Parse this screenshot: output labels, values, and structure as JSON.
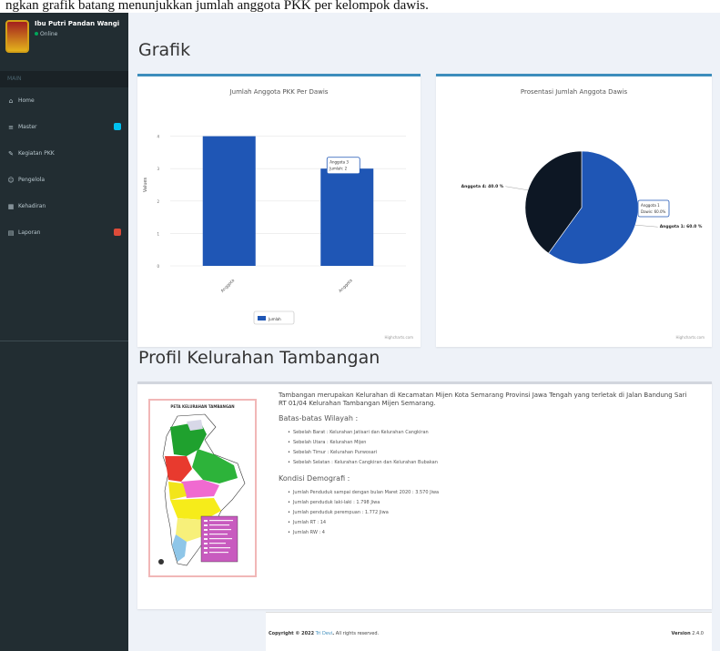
{
  "caption": "ngkan grafik batang menunjukkan jumlah anggota PKK per kelompok dawis.",
  "sidebar": {
    "user_name": "Ibu Putri Pandan Wangi",
    "user_status": "Online",
    "header": "MAIN",
    "items": [
      {
        "label": "Home",
        "icon": "home-icon"
      },
      {
        "label": "Master",
        "icon": "database-icon",
        "badge_color": "#00c0ef"
      },
      {
        "label": "Kegiatan PKK",
        "icon": "pencil-icon"
      },
      {
        "label": "Pengelola",
        "icon": "users-icon"
      },
      {
        "label": "Kehadiran",
        "icon": "table-icon"
      },
      {
        "label": "Laporan",
        "icon": "book-icon",
        "badge_color": "#dd4b39"
      }
    ]
  },
  "grafik": {
    "title": "Grafik",
    "bar_box_title": "Jumlah Anggota PKK Per Dawis",
    "pie_box_title": "Prosentasi Jumlah Anggota Dawis",
    "credits": "Highcharts.com"
  },
  "chart_data": [
    {
      "type": "bar",
      "title": "Jumlah Anggota PKK Per Dawis",
      "ylabel": "Values",
      "categories": [
        "Anggota",
        "Anggota"
      ],
      "series": [
        {
          "name": "Jumlah",
          "values": [
            4,
            3
          ]
        }
      ],
      "ylim": [
        0,
        5
      ],
      "yticks": [
        "0",
        "1",
        "2",
        "3",
        "4"
      ],
      "tooltip": {
        "line1": "Anggota 3",
        "line2": "Jumlah: 2"
      },
      "color": "#1f56b5"
    },
    {
      "type": "pie",
      "title": "Prosentasi Jumlah Anggota Dawis",
      "slices": [
        {
          "name": "Anggota 1",
          "value": 60.0,
          "label": "Anggota 1: 60.0 %",
          "color": "#1f56b5"
        },
        {
          "name": "Anggota 4",
          "value": 40.0,
          "label": "Anggota 4: 40.0 %",
          "color": "#0d1724"
        }
      ],
      "tooltip": {
        "line1": "Anggota 1",
        "line2": "Dawis: 60.0%"
      }
    }
  ],
  "profile": {
    "title": "Profil Kelurahan Tambangan",
    "map_title": "PETA KELURAHAN TAMBANGAN",
    "intro": "Tambangan merupakan Kelurahan di Kecamatan Mijen Kota Semarang Provinsi Jawa Tengah yang terletak di Jalan Bandung Sari RT 01/04 Kelurahan Tambangan Mijen Semarang.",
    "batas_head": "Batas-batas Wilayah :",
    "batas": [
      "Sebelah Barat : Kelurahan Jatisari dan Kelurahan Cangkiran",
      "Sebelah Utara : Kelurahan Mijen",
      "Sebelah Timur : Kelurahan Purwosari",
      "Sebelah Selatan : Kelurahan Cangkiran dan Kelurahan Bubakan"
    ],
    "demo_head": "Kondisi Demografi :",
    "demo": [
      "Jumlah Penduduk sampai dengan bulan Maret 2020 : 3.570 Jiwa",
      "Jumlah penduduk laki-laki : 1.798 Jiwa",
      "Jumlah penduduk perempuan : 1.772 Jiwa",
      "Jumlah RT : 14",
      "Jumlah RW : 4"
    ]
  },
  "footer": {
    "copyright_prefix": "Copyright © 2022",
    "copyright_link": "Tri Devi",
    "copyright_suffix": "All rights reserved.",
    "version_label": "Version",
    "version_value": "2.4.0"
  }
}
